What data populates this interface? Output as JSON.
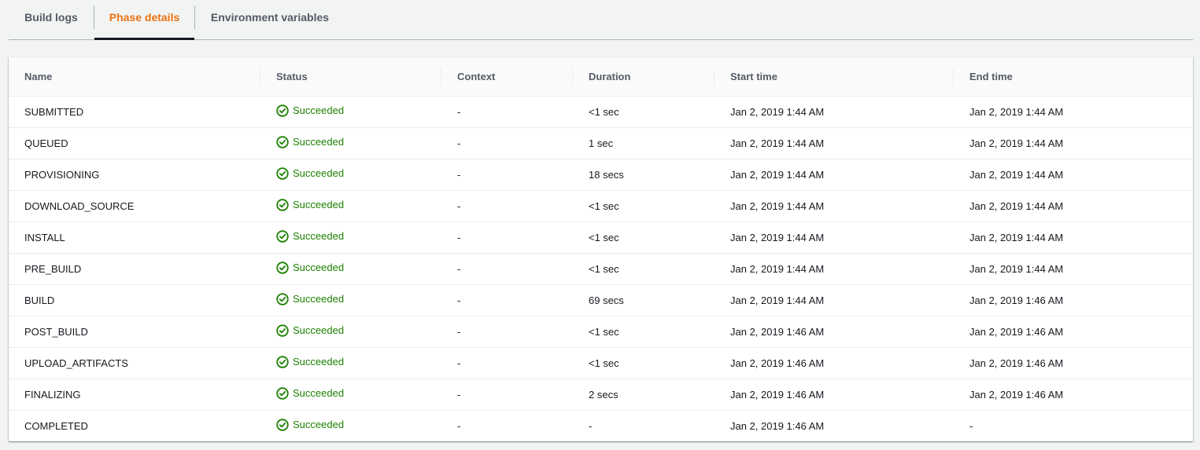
{
  "tabs": [
    {
      "label": "Build logs",
      "active": false
    },
    {
      "label": "Phase details",
      "active": true
    },
    {
      "label": "Environment variables",
      "active": false
    }
  ],
  "colors": {
    "active_tab": "#ec7211",
    "success": "#1d8102"
  },
  "table": {
    "columns": [
      "Name",
      "Status",
      "Context",
      "Duration",
      "Start time",
      "End time"
    ],
    "rows": [
      {
        "name": "SUBMITTED",
        "status": "Succeeded",
        "context": "-",
        "duration": "<1 sec",
        "start": "Jan 2, 2019 1:44 AM",
        "end": "Jan 2, 2019 1:44 AM"
      },
      {
        "name": "QUEUED",
        "status": "Succeeded",
        "context": "-",
        "duration": "1 sec",
        "start": "Jan 2, 2019 1:44 AM",
        "end": "Jan 2, 2019 1:44 AM"
      },
      {
        "name": "PROVISIONING",
        "status": "Succeeded",
        "context": "-",
        "duration": "18 secs",
        "start": "Jan 2, 2019 1:44 AM",
        "end": "Jan 2, 2019 1:44 AM"
      },
      {
        "name": "DOWNLOAD_SOURCE",
        "status": "Succeeded",
        "context": "-",
        "duration": "<1 sec",
        "start": "Jan 2, 2019 1:44 AM",
        "end": "Jan 2, 2019 1:44 AM"
      },
      {
        "name": "INSTALL",
        "status": "Succeeded",
        "context": "-",
        "duration": "<1 sec",
        "start": "Jan 2, 2019 1:44 AM",
        "end": "Jan 2, 2019 1:44 AM"
      },
      {
        "name": "PRE_BUILD",
        "status": "Succeeded",
        "context": "-",
        "duration": "<1 sec",
        "start": "Jan 2, 2019 1:44 AM",
        "end": "Jan 2, 2019 1:44 AM"
      },
      {
        "name": "BUILD",
        "status": "Succeeded",
        "context": "-",
        "duration": "69 secs",
        "start": "Jan 2, 2019 1:44 AM",
        "end": "Jan 2, 2019 1:46 AM"
      },
      {
        "name": "POST_BUILD",
        "status": "Succeeded",
        "context": "-",
        "duration": "<1 sec",
        "start": "Jan 2, 2019 1:46 AM",
        "end": "Jan 2, 2019 1:46 AM"
      },
      {
        "name": "UPLOAD_ARTIFACTS",
        "status": "Succeeded",
        "context": "-",
        "duration": "<1 sec",
        "start": "Jan 2, 2019 1:46 AM",
        "end": "Jan 2, 2019 1:46 AM"
      },
      {
        "name": "FINALIZING",
        "status": "Succeeded",
        "context": "-",
        "duration": "2 secs",
        "start": "Jan 2, 2019 1:46 AM",
        "end": "Jan 2, 2019 1:46 AM"
      },
      {
        "name": "COMPLETED",
        "status": "Succeeded",
        "context": "-",
        "duration": "-",
        "start": "Jan 2, 2019 1:46 AM",
        "end": "-"
      }
    ]
  }
}
